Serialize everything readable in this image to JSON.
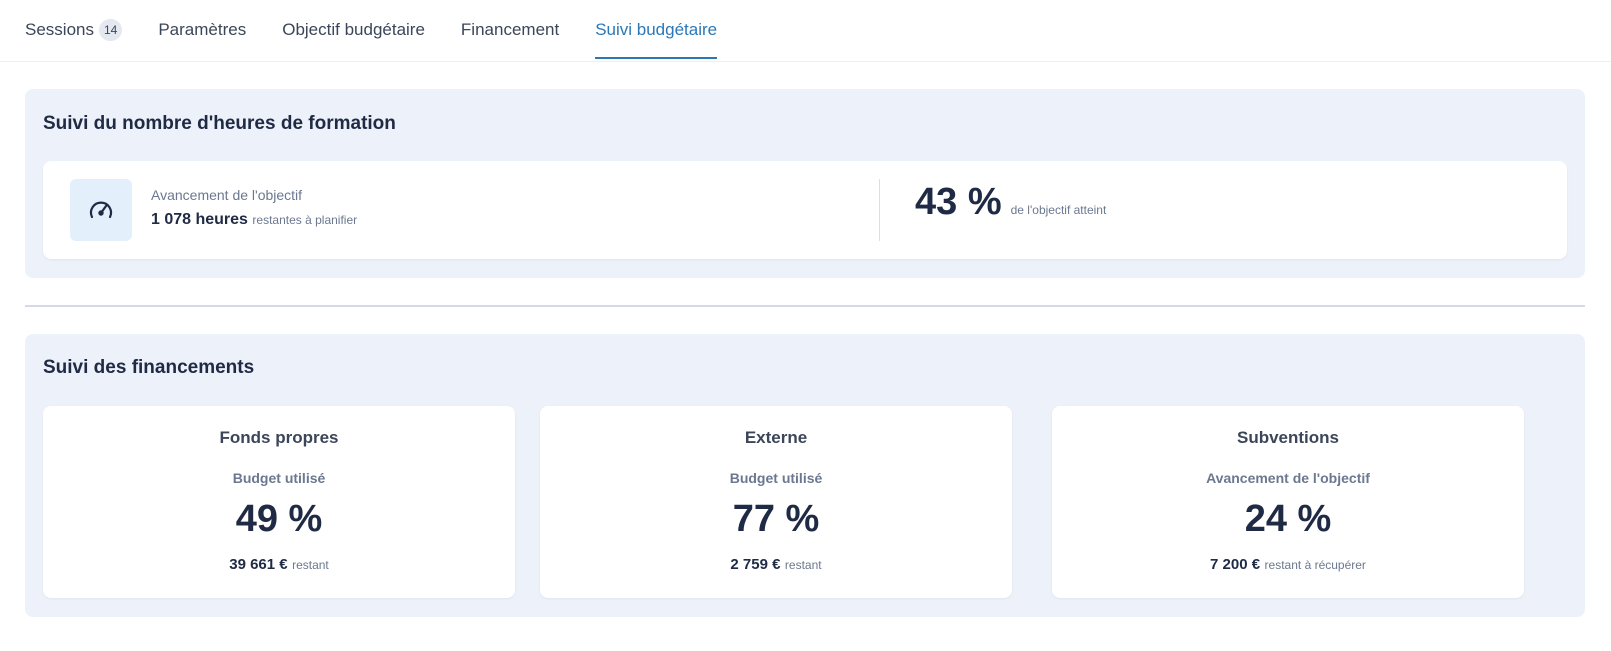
{
  "tabs": [
    {
      "label": "Sessions",
      "badge": "14"
    },
    {
      "label": "Paramètres"
    },
    {
      "label": "Objectif budgétaire"
    },
    {
      "label": "Financement"
    },
    {
      "label": "Suivi budgétaire",
      "active": true
    }
  ],
  "hours": {
    "title": "Suivi du nombre d'heures de formation",
    "label": "Avancement de l'objectif",
    "value": "1 078 heures",
    "value_suffix": "restantes à planifier",
    "percent": "43 %",
    "percent_suffix": "de l'objectif atteint",
    "icon": "gauge-icon"
  },
  "financing": {
    "title": "Suivi des financements",
    "cards": [
      {
        "title": "Fonds propres",
        "subtitle": "Budget utilisé",
        "percent": "49 %",
        "amount": "39 661 €",
        "amount_suffix": "restant"
      },
      {
        "title": "Externe",
        "subtitle": "Budget utilisé",
        "percent": "77 %",
        "amount": "2 759 €",
        "amount_suffix": "restant"
      },
      {
        "title": "Subventions",
        "subtitle": "Avancement de l'objectif",
        "percent": "24 %",
        "amount": "7 200 €",
        "amount_suffix": "restant à récupérer"
      }
    ]
  },
  "colors": {
    "accent": "#2a78b8",
    "panel_bg": "#edf1f9",
    "text_dark": "#1f2a44",
    "text_muted": "#6b7890"
  }
}
